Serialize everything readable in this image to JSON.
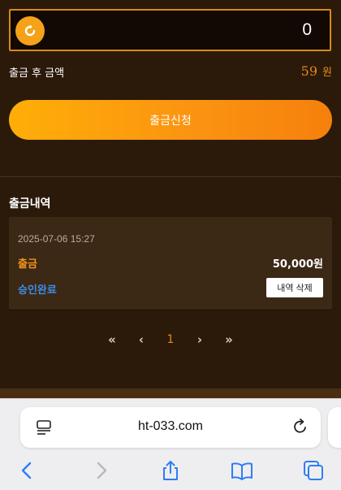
{
  "amount_input": {
    "value": "0",
    "icon": "coin-refresh-icon"
  },
  "after_withdraw": {
    "label": "출금 후 금액",
    "value": "59",
    "unit": "원"
  },
  "withdraw_button": {
    "label": "출금신청"
  },
  "history": {
    "title": "출금내역",
    "items": [
      {
        "date": "2025-07-06 15:27",
        "type": "출금",
        "amount": "50,000원",
        "status": "승인완료",
        "delete_label": "내역 삭제"
      }
    ]
  },
  "pagination": {
    "first": "«",
    "prev": "‹",
    "current": "1",
    "next": "›",
    "last": "»"
  },
  "browser": {
    "url": "ht-033.com",
    "icons": [
      "reader-icon",
      "reload-icon",
      "back-icon",
      "forward-icon",
      "share-icon",
      "bookmarks-icon",
      "tabs-icon"
    ]
  },
  "colors": {
    "background": "#2b1a0a",
    "accent": "#f5a219",
    "status_blue": "#3d8de6"
  }
}
